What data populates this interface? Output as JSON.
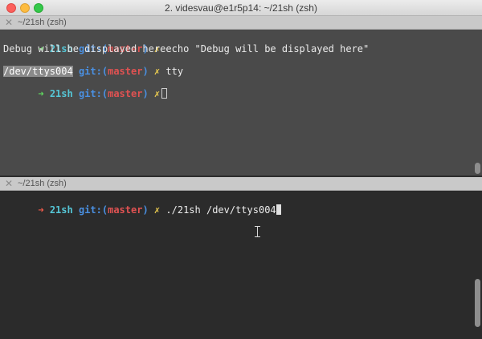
{
  "window": {
    "title": "2. videsvau@e1r5p14: ~/21sh (zsh)"
  },
  "top_pane": {
    "tab_label": "~/21sh (zsh)",
    "lines": [
      {
        "arrow": "➜",
        "dir": "21sh",
        "git": "git:(",
        "branch": "master",
        "git_close": ")",
        "x": "✗",
        "cmd": "echo \"Debug will be displayed here\""
      },
      {
        "output": "Debug will be displayed here"
      },
      {
        "arrow": "➜",
        "dir": "21sh",
        "git": "git:(",
        "branch": "master",
        "git_close": ")",
        "x": "✗",
        "cmd": "tty"
      },
      {
        "output": "/dev/ttys004"
      },
      {
        "arrow": "➜",
        "dir": "21sh",
        "git": "git:(",
        "branch": "master",
        "git_close": ")",
        "x": "✗",
        "cmd": ""
      }
    ]
  },
  "bottom_pane": {
    "tab_label": "~/21sh (zsh)",
    "lines": [
      {
        "arrow": "➜",
        "dir": "21sh",
        "git": "git:(",
        "branch": "master",
        "git_close": ")",
        "x": "✗",
        "cmd": "./21sh /dev/ttys004"
      }
    ]
  },
  "colors": {
    "prompt_arrow_ok": "#5fd75f",
    "prompt_arrow_err": "#f05a4a",
    "dir": "#55c6d6",
    "git": "#4a90e2",
    "branch": "#e05252",
    "dirty_mark": "#f0d050"
  }
}
